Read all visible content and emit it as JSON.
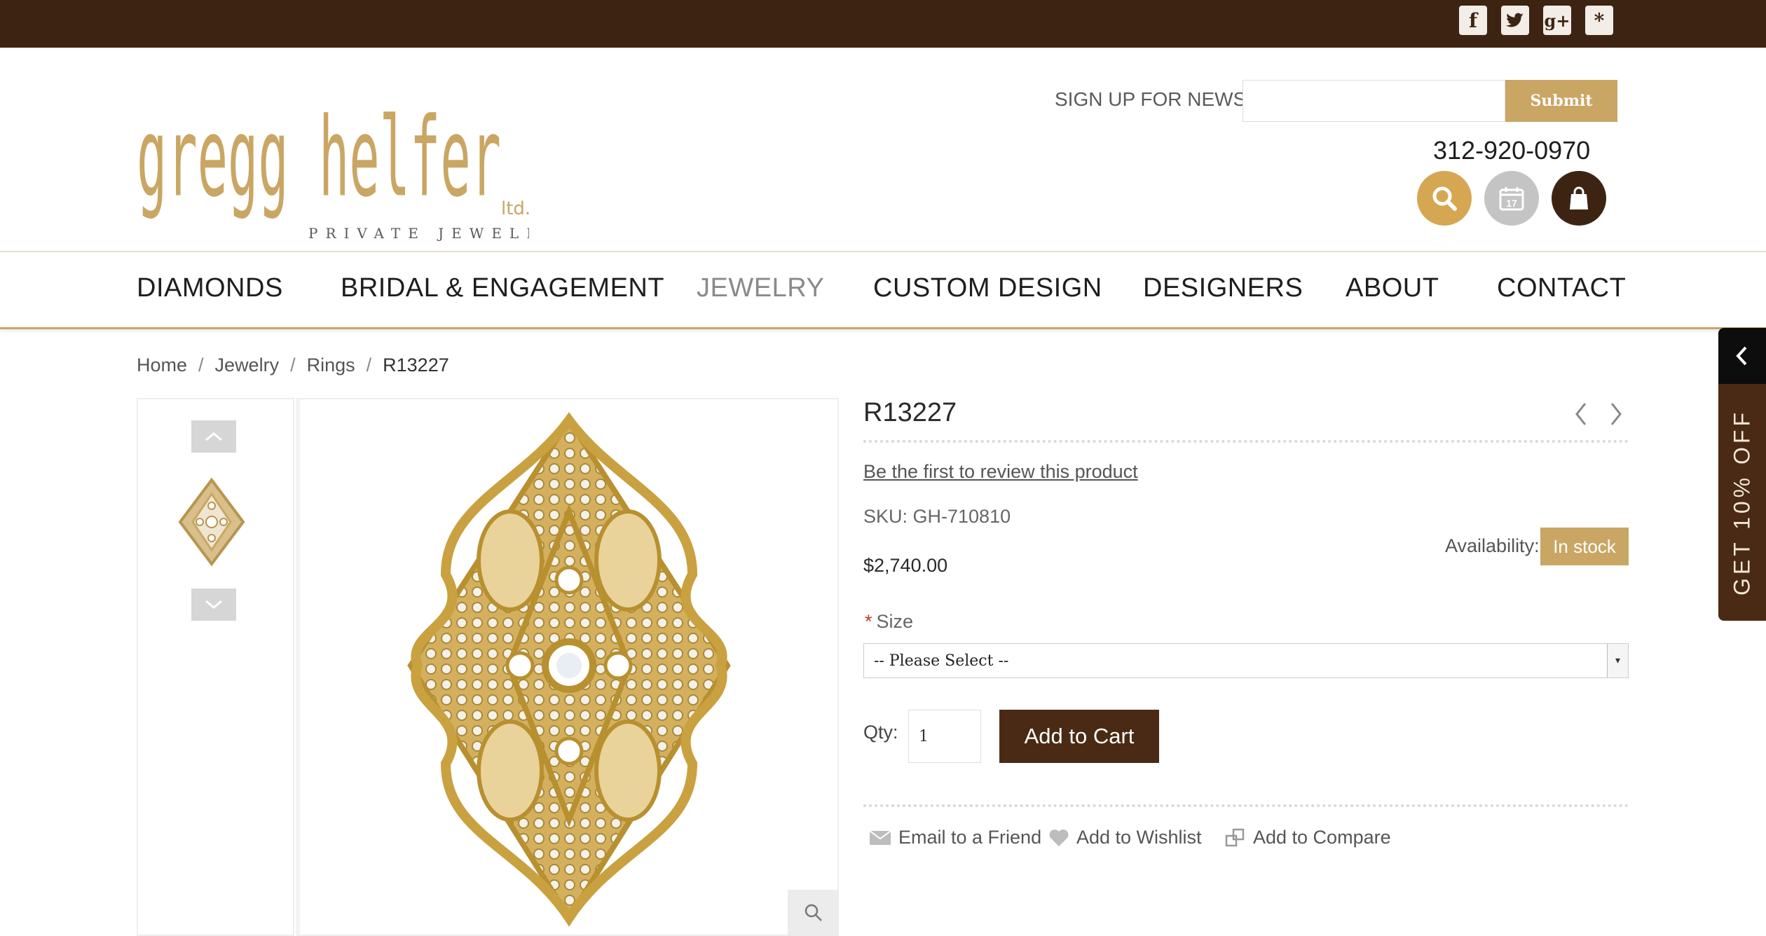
{
  "social": {
    "icons": [
      "facebook-icon",
      "twitter-icon",
      "google-plus-icon",
      "yelp-icon"
    ],
    "glyphs": [
      "f",
      "t",
      "g+",
      "*"
    ]
  },
  "brand": {
    "name": "gregg helfer",
    "suffix": "ltd.",
    "tagline": "PRIVATE JEWELER",
    "color": "#c9a663"
  },
  "newsletter": {
    "label": "SIGN UP FOR NEWS :",
    "placeholder": "",
    "submit_label": "Submit"
  },
  "phone": "312-920-0970",
  "header_buttons": [
    {
      "name": "search-icon",
      "color": "#d6a752"
    },
    {
      "name": "calendar-icon",
      "color": "#c4c4c4",
      "label": "17"
    },
    {
      "name": "shopping-bag-icon",
      "color": "#3d2412"
    }
  ],
  "nav": {
    "items": [
      {
        "label": "DIAMONDS"
      },
      {
        "label": "BRIDAL & ENGAGEMENT"
      },
      {
        "label": "JEWELRY",
        "active": true
      },
      {
        "label": "CUSTOM DESIGN"
      },
      {
        "label": "DESIGNERS"
      },
      {
        "label": "ABOUT"
      },
      {
        "label": "CONTACT"
      }
    ]
  },
  "breadcrumb": {
    "items": [
      "Home",
      "Jewelry",
      "Rings",
      "R13227"
    ],
    "separator": "/"
  },
  "product": {
    "title": "R13227",
    "review_link": "Be the first to review this product",
    "sku": "SKU: GH-710810",
    "availability_label": "Availability:",
    "availability_value": "In stock",
    "price": "$2,740.00",
    "size_label": "Size",
    "size_required": "*",
    "size_selected": "-- Please Select --",
    "qty_label": "Qty:",
    "qty_value": "1",
    "add_to_cart": "Add to Cart",
    "actions": [
      {
        "label": "Email to a Friend",
        "icon": "envelope-icon"
      },
      {
        "label": "Add to Wishlist",
        "icon": "heart-icon"
      },
      {
        "label": "Add to Compare",
        "icon": "compare-icon"
      }
    ]
  },
  "promo_tab": {
    "label": "GET 10% OFF"
  },
  "colors": {
    "dark_brown": "#3d2412",
    "button_brown": "#4a2a14",
    "gold": "#c9a663",
    "gold_icon": "#d6a752"
  }
}
